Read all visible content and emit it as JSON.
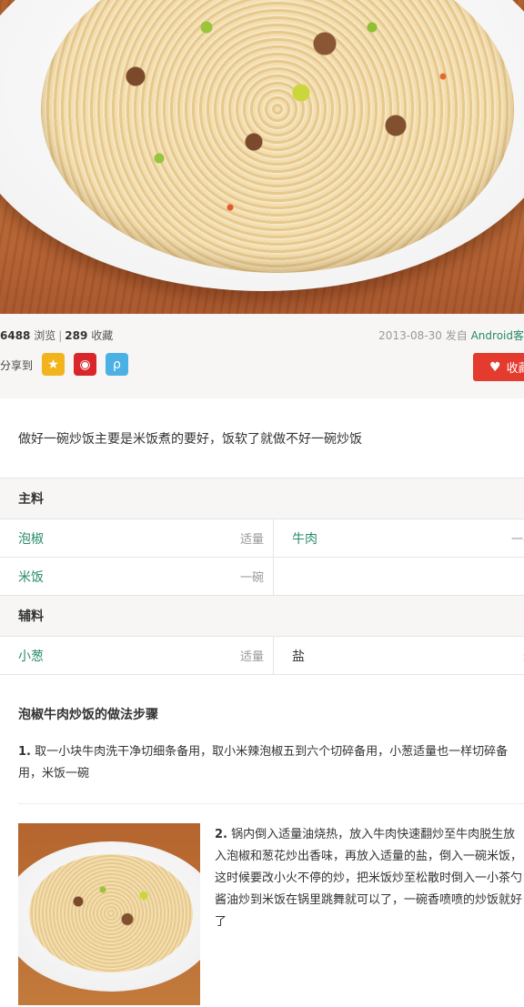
{
  "hero": {
    "image_icon": "fried-rice-photo"
  },
  "stats": {
    "views_count": "6488",
    "views_label": "浏览",
    "separator": "|",
    "favorites_count": "289",
    "favorites_label": "收藏",
    "date": "2013-08-30",
    "posted_from_label": "发自",
    "source": "Android客",
    "share_label": "分享到",
    "favorite_button_label": "收藏"
  },
  "description": "做好一碗炒饭主要是米饭煮的要好，饭软了就做不好一碗炒饭",
  "ingredients": {
    "main_title": "主料",
    "main": [
      {
        "name": "泡椒",
        "qty": "适量"
      },
      {
        "name": "牛肉",
        "qty": "一小"
      },
      {
        "name": "米饭",
        "qty": "一碗"
      }
    ],
    "aux_title": "辅料",
    "aux": [
      {
        "name": "小葱",
        "qty": "适量"
      },
      {
        "name": "盐",
        "qty": "适"
      }
    ]
  },
  "steps": {
    "title": "泡椒牛肉炒饭的做法步骤",
    "items": [
      {
        "num": "1.",
        "text": "取一小块牛肉洗干净切细条备用，取小米辣泡椒五到六个切碎备用，小葱适量也一样切碎备用，米饭一碗"
      },
      {
        "num": "2.",
        "text": "锅内倒入适量油烧热，放入牛肉快速翻炒至牛肉脱生放入泡椒和葱花炒出香味，再放入适量的盐，倒入一碗米饭，这时候要改小火不停的炒，把米饭炒至松散时倒入一小茶勺酱油炒到米饭在锅里跳舞就可以了，一碗香喷喷的炒饭就好了"
      }
    ]
  },
  "colors": {
    "accent_green": "#2a8a6a",
    "favorite_red": "#e43b2f"
  }
}
